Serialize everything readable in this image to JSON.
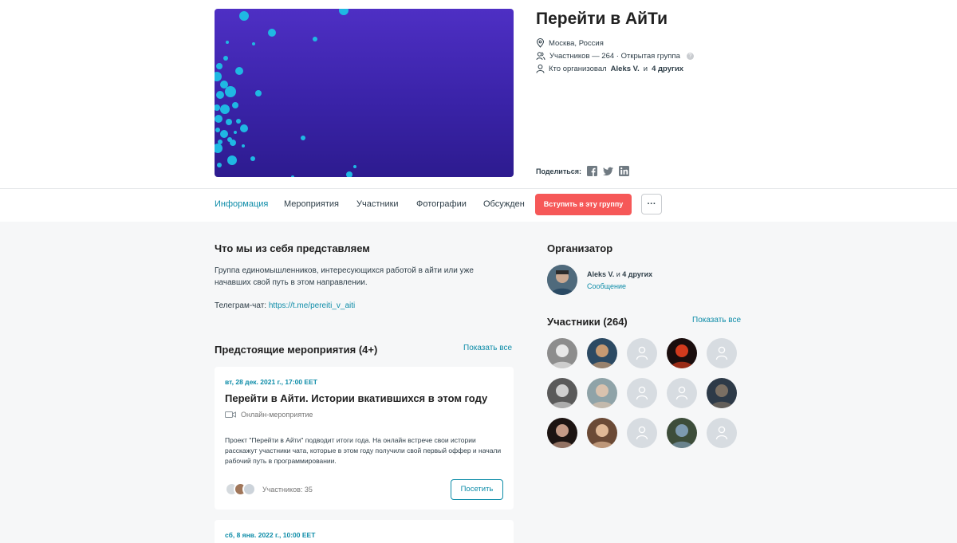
{
  "group": {
    "title": "Перейти в АйТи",
    "location": "Москва, Россия",
    "members_line": "Участников — 264 · Открытая группа",
    "organizer_prefix": "Кто организовал",
    "organizer_name": "Aleks V.",
    "organizer_and": "и",
    "organizer_others": "4 других",
    "share_label": "Поделиться:"
  },
  "tabs": [
    "Информация",
    "Мероприятия",
    "Участники",
    "Фотографии",
    "Обсуждения"
  ],
  "actions": {
    "join_label": "Вступить в эту группу",
    "more_label": "···"
  },
  "about": {
    "heading": "Что мы из себя представляем",
    "description": "Группа единомышленников, интересующихся работой в айти или уже начавших свой путь в этом направлении.",
    "telegram_label": "Телеграм-чат:",
    "telegram_link": "https://t.me/pereiti_v_aiti"
  },
  "events": {
    "heading": "Предстоящие мероприятия (4+)",
    "show_all": "Показать все",
    "items": [
      {
        "date": "вт, 28 дек. 2021 г., 17:00 EET",
        "title": "Перейти в Айти. Истории вкатившихся в этом году",
        "type": "Онлайн-мероприятие",
        "description": "Проект \"Перейти в Айти\" подводит итоги года. На онлайн встрече свои истории расскажут участники чата, которые в этом году получили свой первый оффер и начали рабочий путь в программировании.",
        "attendees": "Участников: 35",
        "visit_label": "Посетить"
      },
      {
        "date": "сб, 8 янв. 2022 г., 10:00 EET"
      }
    ]
  },
  "organizer": {
    "heading": "Организатор",
    "name": "Aleks V.",
    "and": "и",
    "others": "4 других",
    "message": "Сообщение"
  },
  "members": {
    "heading": "Участники (264)",
    "show_all": "Показать все"
  },
  "colors": {
    "accent": "#0d8ca8",
    "join": "#f65858",
    "banner": "#3a23a8",
    "dots": "#1fb8e3"
  }
}
